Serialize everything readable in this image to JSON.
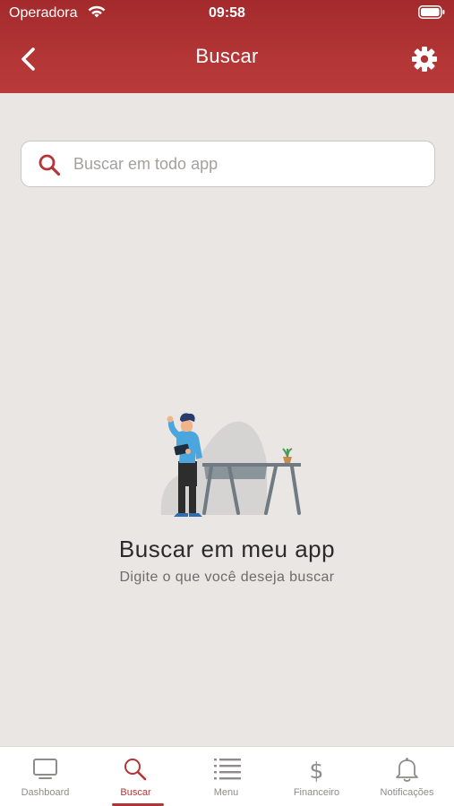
{
  "status_bar": {
    "carrier": "Operadora",
    "time": "09:58"
  },
  "header": {
    "title": "Buscar"
  },
  "search": {
    "placeholder": "Buscar em todo app",
    "value": ""
  },
  "empty_state": {
    "title": "Buscar em meu app",
    "subtitle": "Digite o que você deseja buscar"
  },
  "tabbar": {
    "active": "Buscar",
    "items": [
      {
        "label": "Dashboard",
        "icon": "monitor-icon"
      },
      {
        "label": "Buscar",
        "icon": "search-icon"
      },
      {
        "label": "Menu",
        "icon": "list-icon"
      },
      {
        "label": "Financeiro",
        "icon": "dollar-icon"
      },
      {
        "label": "Notificações",
        "icon": "bell-icon"
      }
    ]
  },
  "colors": {
    "brand": "#b33535",
    "background": "#e9e6e4",
    "inactive": "#8e8c8a"
  }
}
